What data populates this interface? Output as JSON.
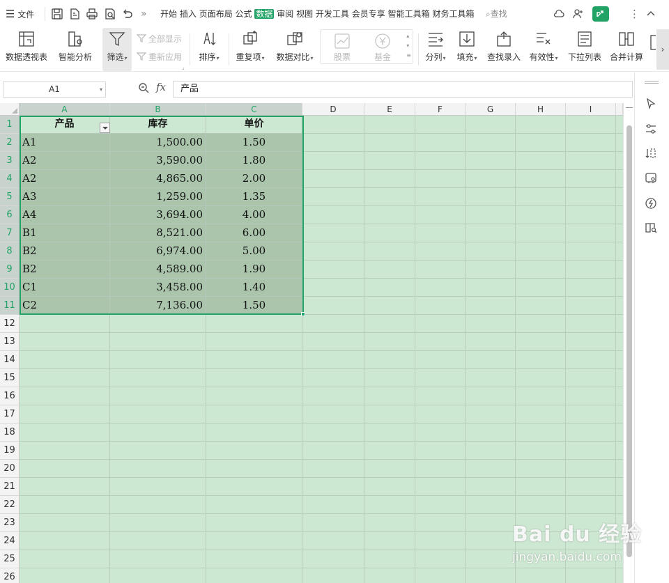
{
  "topbar": {
    "file_menu": "文件",
    "tabs": [
      {
        "label": "开始"
      },
      {
        "label": "插入"
      },
      {
        "label": "页面布局"
      },
      {
        "label": "公式"
      },
      {
        "label": "数据",
        "active": true
      },
      {
        "label": "审阅"
      },
      {
        "label": "视图"
      },
      {
        "label": "开发工具"
      },
      {
        "label": "会员专享"
      },
      {
        "label": "智能工具箱"
      },
      {
        "label": "财务工具箱"
      }
    ],
    "search_label": "查找",
    "more_glyph": "»",
    "accent_color": "#21a366"
  },
  "ribbon": {
    "pivot_table": "数据透视表",
    "smart_analysis": "智能分析",
    "filter": "筛选",
    "show_all": "全部显示",
    "reapply": "重新应用",
    "sort": "排序",
    "duplicates": "重复项",
    "data_compare": "数据对比",
    "stock": "股票",
    "fund": "基金",
    "text_to_columns": "分列",
    "fill": "填充",
    "lookup_entry": "查找录入",
    "validity": "有效性",
    "dropdown_list": "下拉列表",
    "consolidate": "合并计算"
  },
  "formula_bar": {
    "name_box": "A1",
    "fx_label": "fx",
    "content": "产品"
  },
  "sheet": {
    "columns": [
      "A",
      "B",
      "C",
      "D",
      "E",
      "F",
      "G",
      "H",
      "I"
    ],
    "rows": [
      "1",
      "2",
      "3",
      "4",
      "5",
      "6",
      "7",
      "8",
      "9",
      "10",
      "11",
      "12",
      "13",
      "14",
      "15",
      "16",
      "17",
      "18",
      "19",
      "20",
      "21",
      "22",
      "23",
      "24",
      "25",
      "26"
    ],
    "headers": [
      "产品",
      "库存",
      "单价"
    ],
    "data": [
      [
        "A1",
        "1,500.00",
        "1.50"
      ],
      [
        "A2",
        "3,590.00",
        "1.80"
      ],
      [
        "A2",
        "4,865.00",
        "2.00"
      ],
      [
        "A3",
        "1,259.00",
        "1.35"
      ],
      [
        "A4",
        "3,694.00",
        "4.00"
      ],
      [
        "B1",
        "8,521.00",
        "6.00"
      ],
      [
        "B2",
        "6,974.00",
        "5.00"
      ],
      [
        "B2",
        "4,589.00",
        "1.90"
      ],
      [
        "C1",
        "3,458.00",
        "1.40"
      ],
      [
        "C2",
        "7,136.00",
        "1.50"
      ]
    ],
    "cell_background": "#cde8d2",
    "selection_color": "#21a366"
  },
  "watermark": {
    "brand": "Bai du 经验",
    "url": "jingyan.baidu.com"
  }
}
